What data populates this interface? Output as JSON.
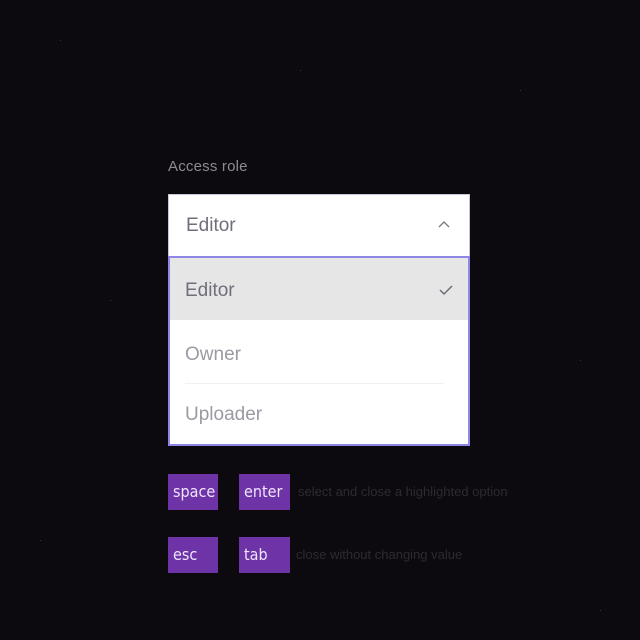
{
  "field": {
    "label": "Access role",
    "value": "Editor",
    "toggle_icon": "chevron-up-icon"
  },
  "menu": {
    "items": [
      {
        "label": "Editor",
        "selected": true,
        "icon": "check-icon"
      },
      {
        "label": "Owner",
        "selected": false
      },
      {
        "label": "Uploader",
        "selected": false
      }
    ]
  },
  "shortcuts": {
    "space_key": "space",
    "enter_key": "enter",
    "select_hint": "select and close a highlighted option",
    "esc_key": "esc",
    "tab_key": "tab",
    "close_hint": "close without changing value"
  },
  "colors": {
    "background": "#0c0a0e",
    "accent_border": "#8f87e8",
    "key_background": "#6f33a8",
    "selected_row": "#e6e6e6"
  }
}
